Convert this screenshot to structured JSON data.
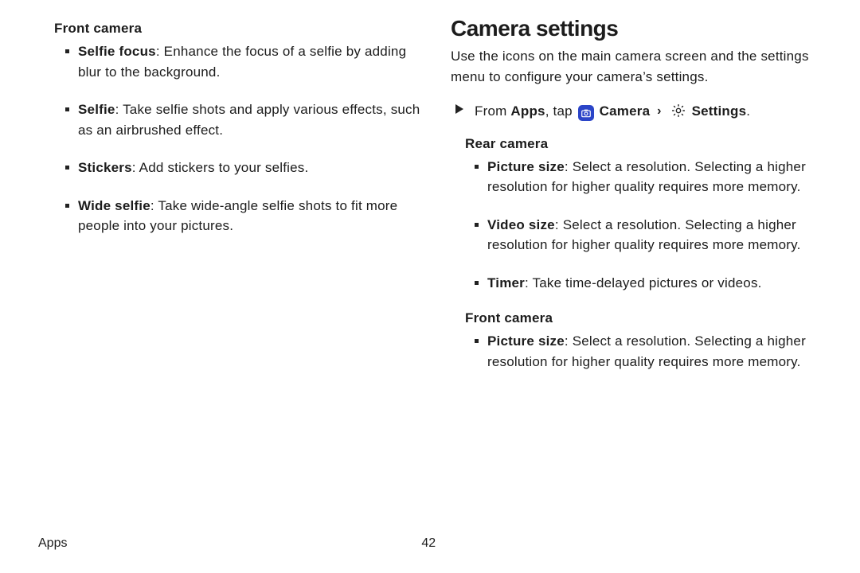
{
  "left": {
    "heading": "Front camera",
    "items": [
      {
        "term": "Selfie focus",
        "desc": ": Enhance the focus of a selfie by adding blur to the background."
      },
      {
        "term": "Selfie",
        "desc": ": Take selfie shots and apply various effects, such as an airbrushed effect."
      },
      {
        "term": "Stickers",
        "desc": ": Add stickers to your selfies."
      },
      {
        "term": "Wide selfie",
        "desc": ": Take wide-angle selfie shots to fit more people into your pictures."
      }
    ]
  },
  "right": {
    "title": "Camera settings",
    "lead": "Use the icons on the main camera screen and the settings menu to configure your camera’s settings.",
    "nav_prefix": "From ",
    "nav_apps": "Apps",
    "nav_tap": ", tap ",
    "nav_camera": "Camera",
    "nav_settings": "Settings",
    "nav_period": ".",
    "group1_heading": "Rear camera",
    "group1_items": [
      {
        "term": "Picture size",
        "desc": ": Select a resolution. Selecting a higher resolution for higher quality requires more memory."
      },
      {
        "term": "Video size",
        "desc": ": Select a resolution. Selecting a higher resolution for higher quality requires more memory."
      },
      {
        "term": "Timer",
        "desc": ": Take time-delayed pictures or videos."
      }
    ],
    "group2_heading": "Front camera",
    "group2_items": [
      {
        "term": "Picture size",
        "desc": ": Select a resolution. Selecting a higher resolution for higher quality requires more memory."
      }
    ]
  },
  "footer": {
    "section": "Apps",
    "page": "42"
  }
}
